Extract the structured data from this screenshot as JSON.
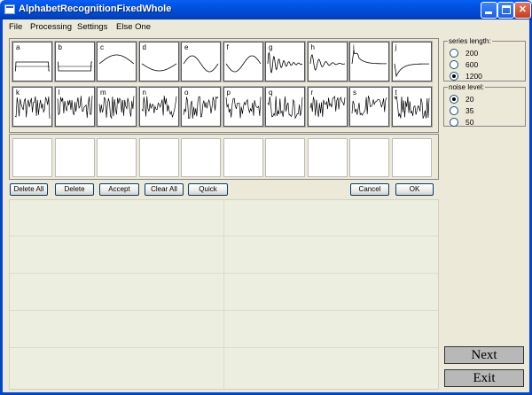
{
  "window": {
    "title": "AlphabetRecognitionFixedWhole"
  },
  "menu": [
    "File",
    "Processing",
    "Settings",
    "Else One"
  ],
  "prototypes": {
    "row1": [
      "a",
      "b",
      "c",
      "d",
      "e",
      "f",
      "g",
      "h",
      "i",
      "j"
    ],
    "row2": [
      "k",
      "l",
      "m",
      "n",
      "o",
      "p",
      "q",
      "r",
      "s",
      "t"
    ]
  },
  "toolbar": {
    "delete_all": "Delete All",
    "delete": "Delete",
    "accept": "Accept",
    "clear_all": "Clear All",
    "quick": "Quick",
    "cancel": "Cancel",
    "ok": "OK"
  },
  "series_length": {
    "title": "series length:",
    "options": [
      "200",
      "600",
      "1200"
    ],
    "selected": "1200"
  },
  "noise_level": {
    "title": "noise level:",
    "options": [
      "20",
      "35",
      "50"
    ],
    "selected": "20"
  },
  "actions": {
    "next": "Next",
    "exit": "Exit"
  }
}
